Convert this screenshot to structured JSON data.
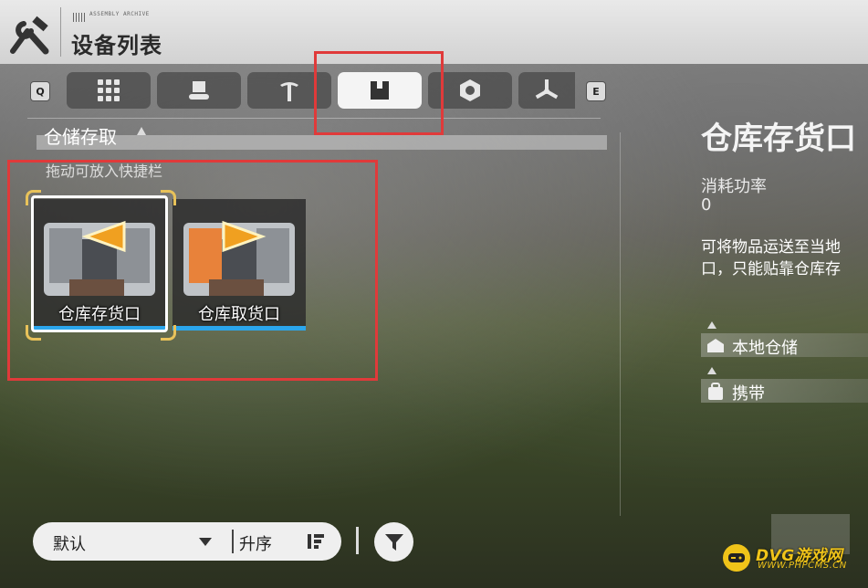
{
  "header": {
    "title": "设备列表",
    "tag": "ASSEMBLY ARCHIVE",
    "icon": "wrench-hammer-icon"
  },
  "tabs": {
    "prev_key": "Q",
    "next_key": "E",
    "items": [
      {
        "icon": "grid-icon",
        "active": false
      },
      {
        "icon": "conveyor-icon",
        "active": false
      },
      {
        "icon": "pickaxe-icon",
        "active": false
      },
      {
        "icon": "storage-box-icon",
        "active": true
      },
      {
        "icon": "hex-nut-icon",
        "active": false
      },
      {
        "icon": "fan-icon",
        "active": false
      }
    ]
  },
  "category": {
    "title": "仓储存取",
    "hint": "拖动可放入快捷栏"
  },
  "devices": [
    {
      "label": "仓库存货口",
      "selected": true,
      "arrow_color": "#f0a020"
    },
    {
      "label": "仓库取货口",
      "selected": false,
      "arrow_color": "#f0a020"
    }
  ],
  "detail": {
    "title": "仓库存货口",
    "power_label": "消耗功率",
    "power_value": "0",
    "description_line1": "可将物品运送至当地",
    "description_line2": "口，只能贴靠仓库存",
    "rows": [
      {
        "label": "本地仓储",
        "icon": "warehouse-icon"
      },
      {
        "label": "携带",
        "icon": "backpack-icon"
      }
    ]
  },
  "sort": {
    "mode": "默认",
    "order": "升序"
  },
  "watermark": {
    "text": "DVG游戏网",
    "sub": "WWW.PHPCMS.CN"
  },
  "colors": {
    "accent_blue": "#2ba6ec",
    "annotation_red": "#e03a3a",
    "selection_gold": "#e8c25a"
  }
}
